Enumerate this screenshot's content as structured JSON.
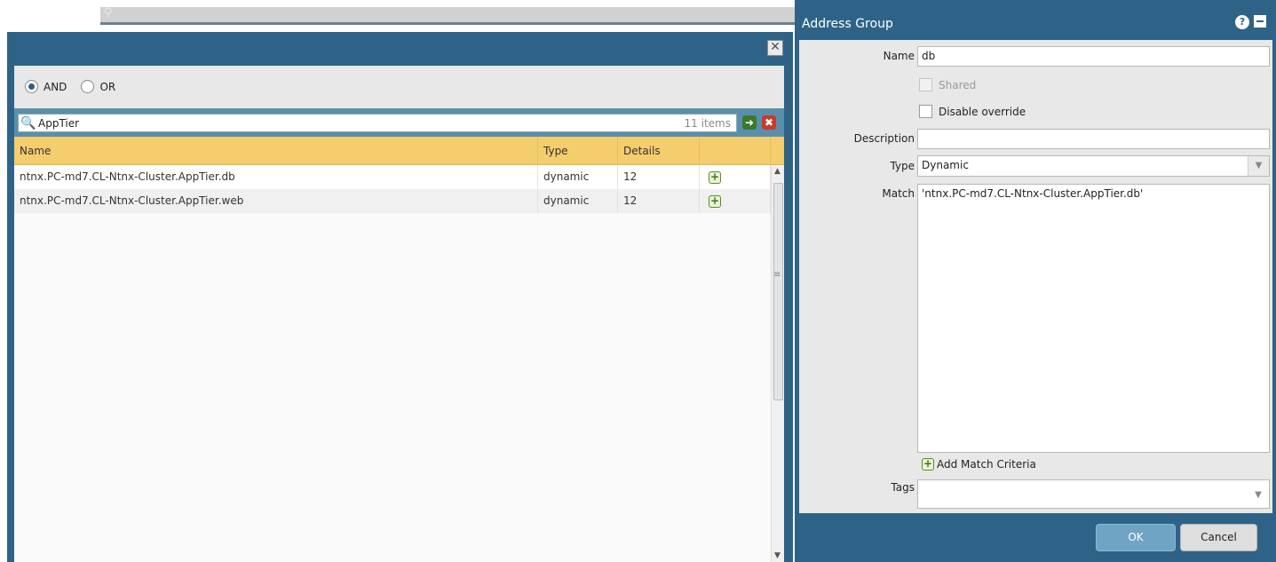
{
  "filter_dialog": {
    "logic": {
      "and_label": "AND",
      "or_label": "OR",
      "selected": "AND"
    },
    "search": {
      "value": "AppTier",
      "items_count": "11 items"
    },
    "columns": {
      "name": "Name",
      "type": "Type",
      "details": "Details"
    },
    "rows": [
      {
        "name": "ntnx.PC-md7.CL-Ntnx-Cluster.AppTier.db",
        "type": "dynamic",
        "details": "12"
      },
      {
        "name": "ntnx.PC-md7.CL-Ntnx-Cluster.AppTier.web",
        "type": "dynamic",
        "details": "12"
      }
    ]
  },
  "address_group": {
    "title": "Address Group",
    "name_label": "Name",
    "name_value": "db",
    "shared_label": "Shared",
    "disable_override_label": "Disable override",
    "description_label": "Description",
    "description_value": "",
    "type_label": "Type",
    "type_value": "Dynamic",
    "match_label": "Match",
    "match_value": "'ntnx.PC-md7.CL-Ntnx-Cluster.AppTier.db'",
    "add_match_label": "Add Match Criteria",
    "tags_label": "Tags",
    "tags_value": "",
    "ok_label": "OK",
    "cancel_label": "Cancel"
  },
  "icons": {
    "help": "help-icon",
    "minimize": "minimize-icon",
    "close": "close-icon",
    "search": "search-icon",
    "go": "arrow-right-icon",
    "clear": "clear-x-icon",
    "add": "plus-icon"
  },
  "colors": {
    "dialog_header": "#2e6387",
    "grid_header": "#f4cd6d",
    "ok_button": "#6fa4c4"
  }
}
